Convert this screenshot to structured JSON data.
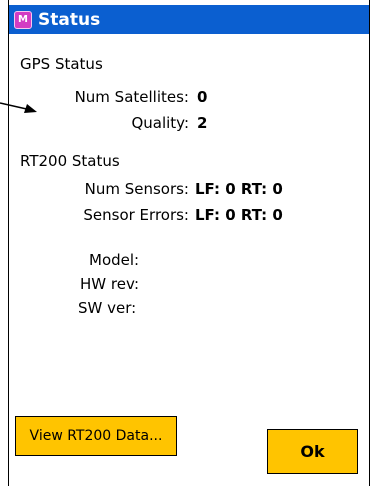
{
  "window": {
    "title": "Status"
  },
  "gps": {
    "heading": "GPS Status",
    "num_satellites_label": "Num Satellites:",
    "num_satellites_value": "0",
    "quality_label": "Quality:",
    "quality_value": "2"
  },
  "rt200": {
    "heading": "RT200 Status",
    "num_sensors_label": "Num Sensors:",
    "num_sensors_value": "LF: 0  RT: 0",
    "sensor_errors_label": "Sensor Errors:",
    "sensor_errors_value": "LF: 0  RT: 0",
    "model_label": "Model:",
    "hw_rev_label": "HW rev:",
    "sw_ver_label": "SW ver:"
  },
  "buttons": {
    "view_rt200": "View RT200 Data...",
    "ok": "Ok"
  },
  "colors": {
    "titlebar": "#0b5fd0",
    "button": "#ffc400",
    "app_icon": "#d23cc3"
  },
  "icons": {
    "app": "app-icon",
    "pointer": "arrow-icon"
  }
}
